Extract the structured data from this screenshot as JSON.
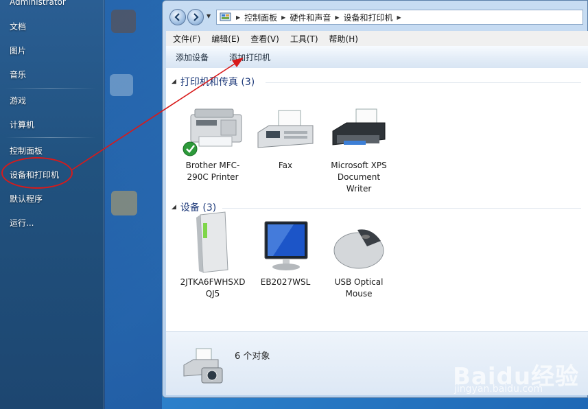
{
  "start_menu": {
    "user": "Administrator",
    "items": [
      {
        "label": "文档"
      },
      {
        "label": "图片"
      },
      {
        "label": "音乐"
      },
      {
        "label": "游戏"
      },
      {
        "label": "计算机"
      },
      {
        "label": "控制面板"
      },
      {
        "label": "设备和打印机"
      },
      {
        "label": "默认程序"
      },
      {
        "label": "运行..."
      }
    ]
  },
  "window": {
    "breadcrumbs": [
      "控制面板",
      "硬件和声音",
      "设备和打印机"
    ],
    "menus": [
      "文件(F)",
      "编辑(E)",
      "查看(V)",
      "工具(T)",
      "帮助(H)"
    ],
    "commands": [
      "添加设备",
      "添加打印机"
    ],
    "groups": [
      {
        "title": "打印机和传真 (3)",
        "items": [
          {
            "label": "Brother MFC-290C Printer",
            "icon": "printer-mfc-icon",
            "default": true
          },
          {
            "label": "Fax",
            "icon": "fax-icon"
          },
          {
            "label": "Microsoft XPS Document Writer",
            "icon": "xps-printer-icon"
          }
        ]
      },
      {
        "title": "设备 (3)",
        "items": [
          {
            "label": "2JTKA6FWHSXDQJ5",
            "icon": "computer-tower-icon"
          },
          {
            "label": "EB2027WSL",
            "icon": "monitor-icon"
          },
          {
            "label": "USB Optical Mouse",
            "icon": "mouse-icon"
          }
        ]
      }
    ],
    "status": "6 个对象"
  },
  "watermark": {
    "brand": "Baidu经验",
    "url": "jingyan.baidu.com"
  },
  "colors": {
    "annotation": "#d81a1a",
    "link_text": "#1e3a7a"
  }
}
